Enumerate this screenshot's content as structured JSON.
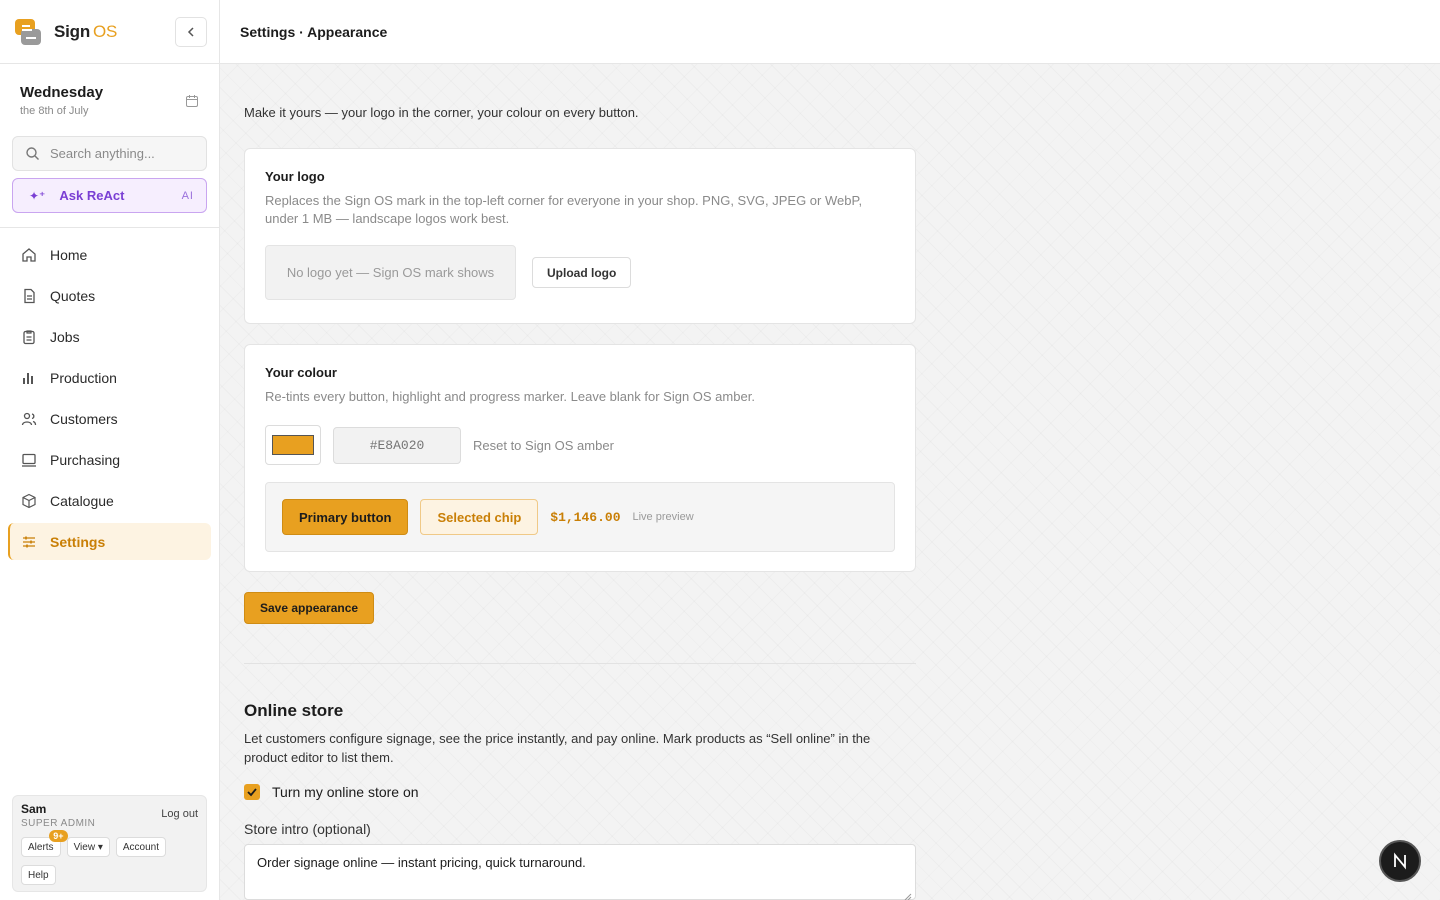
{
  "brand": {
    "name": "Sign",
    "suffix": "OS"
  },
  "page": {
    "title": "Settings · Appearance"
  },
  "date": {
    "day": "Wednesday",
    "sub": "the 8th of July"
  },
  "search": {
    "placeholder": "Search anything..."
  },
  "ask": {
    "label": "Ask ReAct",
    "tag": "AI"
  },
  "nav": [
    {
      "label": "Home",
      "icon": "home-icon"
    },
    {
      "label": "Quotes",
      "icon": "document-icon"
    },
    {
      "label": "Jobs",
      "icon": "clipboard-icon"
    },
    {
      "label": "Production",
      "icon": "bar-chart-icon"
    },
    {
      "label": "Customers",
      "icon": "users-icon"
    },
    {
      "label": "Purchasing",
      "icon": "monitor-icon"
    },
    {
      "label": "Catalogue",
      "icon": "box-icon"
    },
    {
      "label": "Settings",
      "icon": "sliders-icon",
      "active": true
    }
  ],
  "user": {
    "name": "Sam",
    "role": "SUPER ADMIN",
    "logout": "Log out",
    "alerts": "Alerts",
    "alerts_badge": "9+",
    "view": "View ▾",
    "account": "Account",
    "help": "Help"
  },
  "appearance": {
    "intro": "Make it yours — your logo in the corner, your colour on every button.",
    "logo": {
      "title": "Your logo",
      "desc": "Replaces the Sign OS mark in the top-left corner for everyone in your shop. PNG, SVG, JPEG or WebP, under 1 MB — landscape logos work best.",
      "placeholder": "No logo yet — Sign OS mark shows",
      "upload": "Upload logo"
    },
    "colour": {
      "title": "Your colour",
      "desc": "Re-tints every button, highlight and progress marker. Leave blank for Sign OS amber.",
      "swatch": "#E8A020",
      "hex_placeholder": "#E8A020",
      "reset": "Reset to Sign OS amber",
      "preview": {
        "primary": "Primary button",
        "chip": "Selected chip",
        "price": "$1,146.00",
        "live": "Live preview"
      }
    },
    "save": "Save appearance"
  },
  "store": {
    "title": "Online store",
    "desc": "Let customers configure signage, see the price instantly, and pay online. Mark products as “Sell online” in the product editor to list them.",
    "toggle": "Turn my online store on",
    "toggle_checked": true,
    "intro_label": "Store intro (optional)",
    "intro_value": "Order signage online — instant pricing, quick turnaround."
  },
  "colors": {
    "accent": "#E8A020",
    "ai": "#7A3FD4"
  }
}
